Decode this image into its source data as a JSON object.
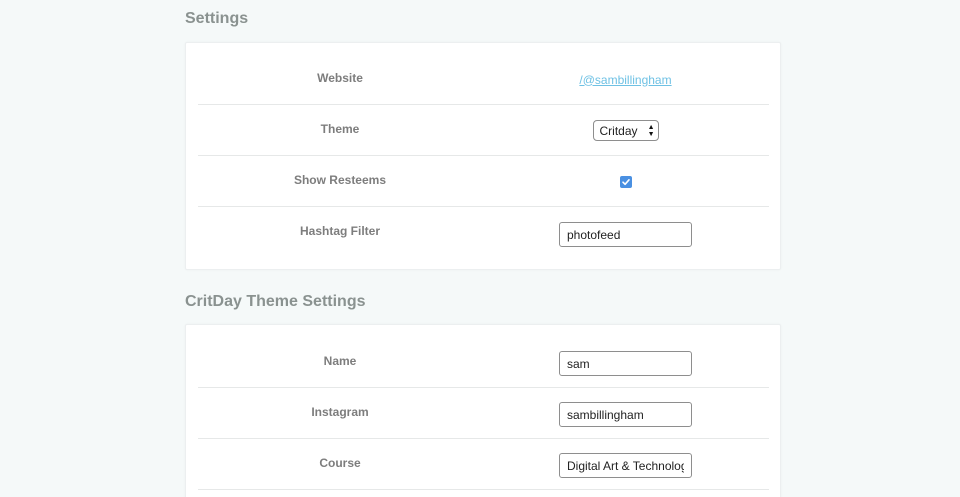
{
  "settings": {
    "title": "Settings",
    "website": {
      "label": "Website",
      "value": "/@sambillingham"
    },
    "theme": {
      "label": "Theme",
      "selected": "Critday"
    },
    "show_resteems": {
      "label": "Show Resteems",
      "checked": true
    },
    "hashtag_filter": {
      "label": "Hashtag Filter",
      "value": "photofeed"
    }
  },
  "critday": {
    "title": "CritDay Theme Settings",
    "name": {
      "label": "Name",
      "value": "sam"
    },
    "instagram": {
      "label": "Instagram",
      "value": "sambillingham"
    },
    "course": {
      "label": "Course",
      "value": "Digital Art & Technology"
    }
  },
  "colors": {
    "link": "#6ec1e4",
    "checkbox": "#4a90e2",
    "section_title": "#8a9290",
    "label": "#7d7d7d"
  }
}
